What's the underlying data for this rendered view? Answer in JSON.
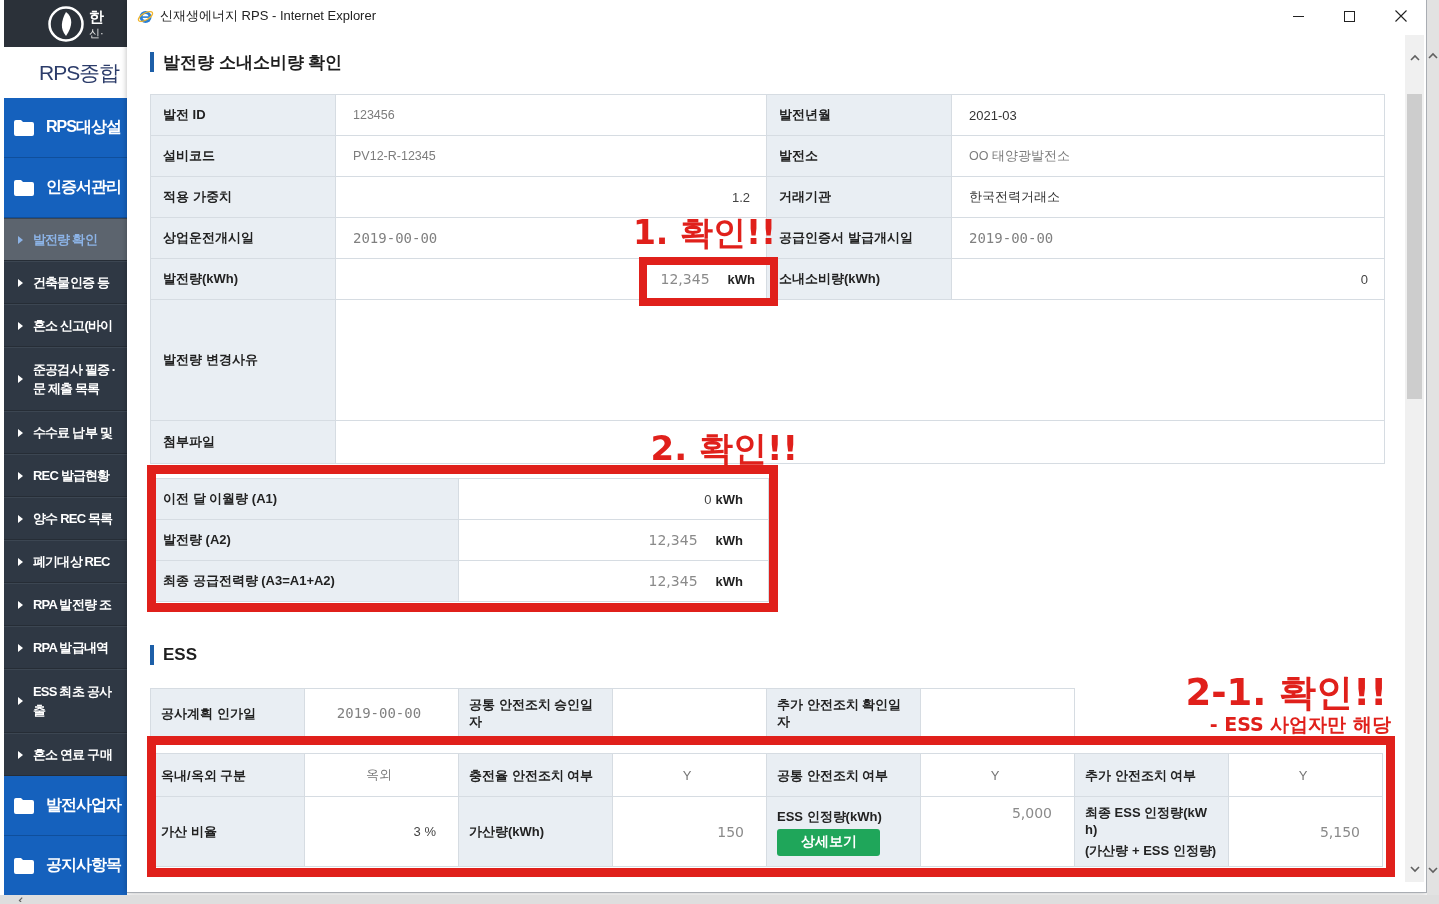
{
  "background_app": {
    "logo": {
      "line_1": "한",
      "line_2": "신·"
    },
    "site_title": "RPS종합",
    "menu": [
      {
        "label": "RPS대상설",
        "selected": false
      },
      {
        "label": "인증서관리",
        "selected": false,
        "children": [
          {
            "label": "발전량 확인",
            "selected": true
          },
          {
            "label": "건축물인증 등",
            "selected": false
          },
          {
            "label": "혼소 신고(바이",
            "selected": false
          },
          {
            "label": "준공검사 필증 ·\n문 제출 목록",
            "selected": false
          },
          {
            "label": "수수료 납부 및",
            "selected": false
          },
          {
            "label": "REC 발급현황",
            "selected": false
          },
          {
            "label": "양수 REC 목록",
            "selected": false
          },
          {
            "label": "폐기대상 REC",
            "selected": false
          },
          {
            "label": "RPA 발전량 조",
            "selected": false
          },
          {
            "label": "RPA 발급내역",
            "selected": false
          },
          {
            "label": "ESS 최초 공사\n출",
            "selected": false
          },
          {
            "label": "혼소 연료 구매",
            "selected": false
          }
        ]
      },
      {
        "label": "발전사업자",
        "selected": false
      },
      {
        "label": "공지사항목",
        "selected": false
      }
    ]
  },
  "window": {
    "title": "신재생에너지 RPS - Internet Explorer"
  },
  "generation": {
    "heading": "발전량 소내소비량 확인",
    "rows": [
      {
        "kind": "fields",
        "cells": [
          {
            "label": "발전 ID",
            "value": "123456",
            "kind": "muted"
          },
          {
            "label": "발전년월",
            "value": "2021-03",
            "kind": "text"
          }
        ]
      },
      {
        "kind": "fields",
        "cells": [
          {
            "label": "설비코드",
            "value": "PV12-R-12345",
            "kind": "muted"
          },
          {
            "label": "발전소",
            "value": "OO 태양광발전소",
            "kind": "muted"
          }
        ]
      },
      {
        "kind": "fields",
        "cells": [
          {
            "label": "적용 가중치",
            "value": "1.2",
            "kind": "number"
          },
          {
            "label": "거래기관",
            "value": "한국전력거래소",
            "kind": "text"
          }
        ]
      },
      {
        "kind": "fields",
        "cells": [
          {
            "label": "상업운전개시일",
            "value": "2019-00-00",
            "kind": "date"
          },
          {
            "label": "공급인증서 발급개시일",
            "value": "2019-00-00",
            "kind": "date"
          }
        ]
      },
      {
        "kind": "fields",
        "cells": [
          {
            "label": "발전량(kWh)",
            "value": "12,345",
            "unit": "kWh",
            "kind": "amount",
            "callout": {
              "text": "1. 확인!!"
            }
          },
          {
            "label": "소내소비량(kWh)",
            "value": "0",
            "kind": "number"
          }
        ]
      },
      {
        "kind": "memo",
        "cells": [
          {
            "label": "발전량 변경사유"
          }
        ]
      },
      {
        "kind": "attachment",
        "cells": [
          {
            "label": "첨부파일"
          }
        ]
      }
    ]
  },
  "supply": {
    "callout": {
      "text": "2. 확인!!"
    },
    "rows": [
      {
        "label": "이전 달 이월량 (A1)",
        "value": "0",
        "unit": "kWh",
        "kind": "number"
      },
      {
        "label": "발전량 (A2)",
        "value": "12,345",
        "unit": "kWh",
        "kind": "amount"
      },
      {
        "label": "최종 공급전력량 (A3=A1+A2)",
        "value": "12,345",
        "unit": "kWh",
        "kind": "amount"
      }
    ]
  },
  "ess": {
    "heading": "ESS",
    "tables": [
      {
        "rows": [
          {
            "cells": [
              {
                "label": "공사계획 인가일",
                "value": "2019-00-00",
                "kind": "date"
              },
              {
                "label": "공통 안전조치 승인일자"
              },
              {
                "label": "추가 안전조치 확인일자"
              }
            ]
          }
        ]
      },
      {
        "callout": {
          "text": "2-1. 확인!!",
          "note": "- ESS 사업자만 해당"
        },
        "rows": [
          {
            "cells": [
              {
                "label": "옥내/옥외 구분",
                "value": "옥외",
                "kind": "choice"
              },
              {
                "label": "충전율 안전조치 여부",
                "value": "Y",
                "kind": "choice"
              },
              {
                "label": "공통 안전조치 여부",
                "value": "Y",
                "kind": "choice"
              },
              {
                "label": "추가 안전조치 여부",
                "value": "Y",
                "kind": "choice"
              }
            ]
          },
          {
            "cells": [
              {
                "label": "가산 비율",
                "value": "3 %",
                "kind": "number"
              },
              {
                "label": "가산량(kWh)",
                "value": "150",
                "kind": "amount"
              },
              {
                "label": "ESS 인정량(kWh)",
                "button": "상세보기",
                "value": "5,000",
                "kind": "amount"
              },
              {
                "label": "최종 ESS 인정량(kWh)",
                "note": "(가산량 + ESS 인정량)",
                "value": "5,150",
                "kind": "amount"
              }
            ]
          }
        ]
      }
    ]
  }
}
